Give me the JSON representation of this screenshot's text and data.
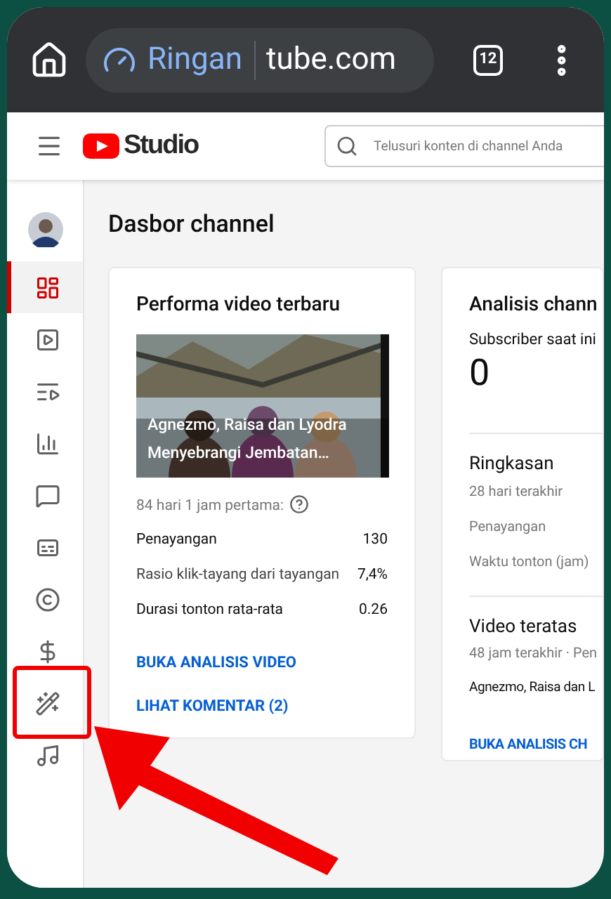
{
  "browser": {
    "mode_label": "Ringan",
    "url": "tube.com",
    "tab_count": "12"
  },
  "header": {
    "logo_text": "Studio",
    "search": {
      "placeholder": "Telusuri konten di channel Anda"
    }
  },
  "sidebar": {
    "items": [
      {
        "kind": "dashboard",
        "selected": true
      },
      {
        "kind": "content",
        "selected": false
      },
      {
        "kind": "playlists",
        "selected": false
      },
      {
        "kind": "analytics",
        "selected": false
      },
      {
        "kind": "comments",
        "selected": false
      },
      {
        "kind": "subtitles",
        "selected": false
      },
      {
        "kind": "copyright",
        "selected": false
      },
      {
        "kind": "earn",
        "selected": false
      },
      {
        "kind": "customize",
        "selected": false,
        "highlighted": true
      },
      {
        "kind": "audio",
        "selected": false
      }
    ]
  },
  "page_title": "Dasbor channel",
  "video_card": {
    "title": "Performa video terbaru",
    "video_title": "Agnezmo, Raisa dan Lyodra Menyebrangi Jembatan…",
    "period": "84 hari 1 jam pertama:",
    "stats": [
      {
        "label": "Penayangan",
        "value": "130"
      },
      {
        "label": "Rasio klik-tayang dari tayangan",
        "value": "7,4%"
      },
      {
        "label": "Durasi tonton rata-rata",
        "value": "0.26"
      }
    ],
    "links": [
      "BUKA ANALISIS VIDEO",
      "LIHAT KOMENTAR (2)"
    ]
  },
  "channel_card": {
    "title": "Analisis chann",
    "subscriber_label": "Subscriber saat ini",
    "subscriber_count": "0",
    "summary": {
      "title": "Ringkasan",
      "period": "28 hari terakhir",
      "metrics": [
        "Penayangan",
        "Waktu tonton (jam)"
      ]
    },
    "top_videos": {
      "title": "Video teratas",
      "period": "48 jam terakhir · Pen",
      "video": "Agnezmo, Raisa dan L"
    },
    "link": "BUKA ANALISIS CH"
  }
}
